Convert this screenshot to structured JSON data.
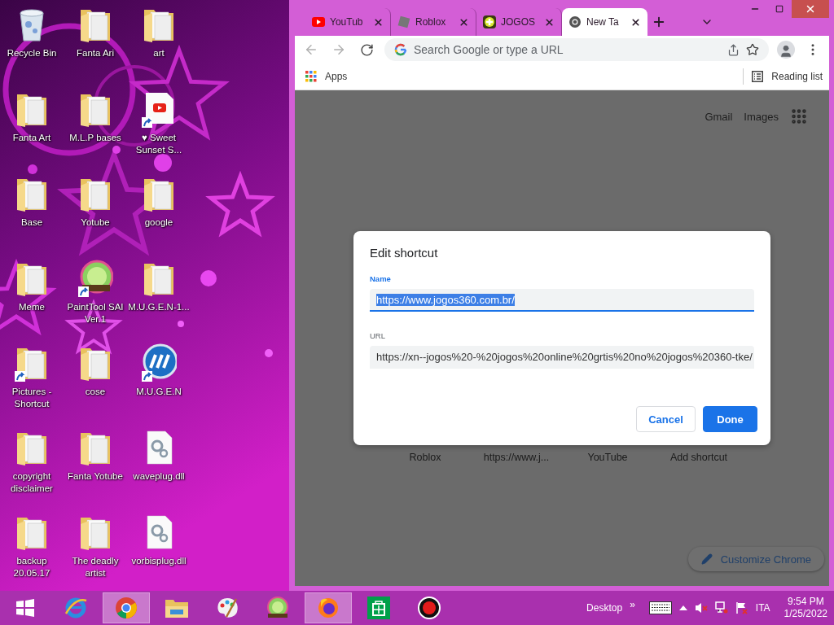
{
  "desktop": {
    "icons": [
      {
        "label": "Recycle Bin",
        "kind": "recycle-bin",
        "shortcut": false
      },
      {
        "label": "Fanta Ari",
        "kind": "folder",
        "shortcut": false
      },
      {
        "label": "art",
        "kind": "folder",
        "shortcut": false
      },
      {
        "label": "Fanta Art",
        "kind": "folder",
        "shortcut": false
      },
      {
        "label": "M.L.P bases",
        "kind": "folder",
        "shortcut": false
      },
      {
        "label": "♥ Sweet Sunset S...",
        "kind": "video-file",
        "shortcut": true
      },
      {
        "label": "Base",
        "kind": "folder",
        "shortcut": false
      },
      {
        "label": "Yotube",
        "kind": "folder",
        "shortcut": false
      },
      {
        "label": "google",
        "kind": "folder",
        "shortcut": false
      },
      {
        "label": "Meme",
        "kind": "folder",
        "shortcut": false
      },
      {
        "label": "PaintTool SAI Ver.1",
        "kind": "app",
        "shortcut": true
      },
      {
        "label": "M.U.G.E.N-1...",
        "kind": "folder",
        "shortcut": false
      },
      {
        "label": "Pictures - Shortcut",
        "kind": "folder",
        "shortcut": true
      },
      {
        "label": "cose",
        "kind": "folder",
        "shortcut": false
      },
      {
        "label": "M.U.G.E.N",
        "kind": "logo-app",
        "shortcut": true
      },
      {
        "label": "copyright disclaimer",
        "kind": "folder",
        "shortcut": false
      },
      {
        "label": "Fanta Yotube",
        "kind": "folder",
        "shortcut": false
      },
      {
        "label": "waveplug.dll",
        "kind": "settings-file",
        "shortcut": false
      },
      {
        "label": "backup 20.05.17",
        "kind": "folder",
        "shortcut": false
      },
      {
        "label": "The deadly artist",
        "kind": "folder",
        "shortcut": false
      },
      {
        "label": "vorbisplug.dll",
        "kind": "settings-file",
        "shortcut": false
      }
    ]
  },
  "browser": {
    "tabs": [
      {
        "label": "YouTub",
        "kind": "video",
        "selected": false
      },
      {
        "label": "Roblox",
        "kind": "game",
        "selected": false
      },
      {
        "label": "JOGOS",
        "kind": "games-site",
        "selected": false
      },
      {
        "label": "New Ta",
        "kind": "chrome",
        "selected": true
      }
    ],
    "address_bar": {
      "placeholder": "Search Google or type a URL"
    },
    "bookmarks": {
      "apps": "Apps",
      "reading_list": "Reading list"
    },
    "page": {
      "header_links": [
        "Gmail",
        "Images"
      ],
      "shortcuts": [
        "Roblox",
        "https://www.j...",
        "YouTube",
        "Add shortcut"
      ],
      "customize": "Customize Chrome"
    },
    "dialog": {
      "title": "Edit shortcut",
      "fields": [
        {
          "label": "Name",
          "value": "https://www.jogos360.com.br/",
          "focused": true
        },
        {
          "label": "URL",
          "value": "https://xn--jogos%20-%20jogos%20online%20grtis%20no%20jogos%20360-tke/",
          "focused": false
        }
      ],
      "buttons": [
        {
          "label": "Cancel",
          "kind": "secondary"
        },
        {
          "label": "Done",
          "kind": "primary"
        }
      ]
    }
  },
  "taskbar": {
    "apps": [
      {
        "kind": "start",
        "active": false
      },
      {
        "kind": "ie",
        "active": false
      },
      {
        "kind": "chrome",
        "active": true
      },
      {
        "kind": "explorer",
        "active": false
      },
      {
        "kind": "paint",
        "active": false
      },
      {
        "kind": "sai",
        "active": false
      },
      {
        "kind": "firefox",
        "active": true
      },
      {
        "kind": "store",
        "active": false
      },
      {
        "kind": "record",
        "active": false
      }
    ],
    "toolbar_label": "Desktop",
    "chevron": "»",
    "language": "ITA",
    "time": "9:54 PM",
    "date": "1/25/2022"
  }
}
